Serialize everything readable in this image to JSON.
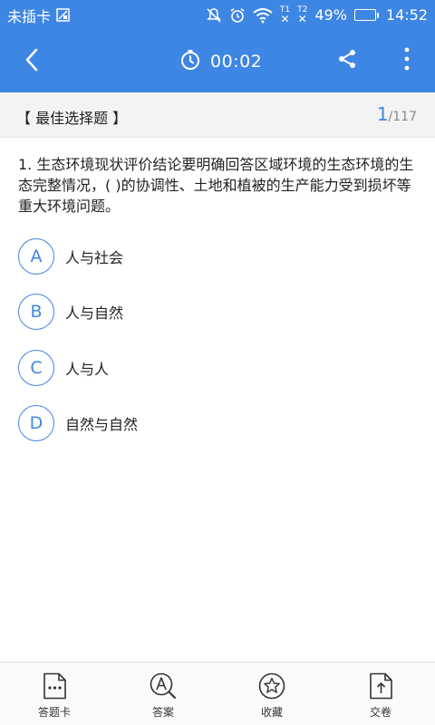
{
  "status_bar": {
    "carrier": "未插卡",
    "sim1_label": "T1",
    "sim2_label": "T2",
    "battery_percent": "49%",
    "battery_level": 0.49,
    "time": "14:52",
    "icons": [
      "sim-off-icon",
      "mute-icon",
      "alarm-icon",
      "wifi-icon",
      "signal-1-icon",
      "signal-2-icon",
      "battery-icon"
    ]
  },
  "app_bar": {
    "timer": "00:02",
    "icons": [
      "back-arrow-icon",
      "stopwatch-icon",
      "share-icon",
      "more-vertical-icon"
    ]
  },
  "question_header": {
    "type_label": "【 最佳选择题 】",
    "current": "1",
    "total": "/117"
  },
  "question": {
    "text": "1. 生态环境现状评价结论要明确回答区域环境的生态环境的生态完整情况，(  )的协调性、土地和植被的生产能力受到损坏等重大环境问题。"
  },
  "options": [
    {
      "letter": "A",
      "text": "人与社会"
    },
    {
      "letter": "B",
      "text": "人与自然"
    },
    {
      "letter": "C",
      "text": "人与人"
    },
    {
      "letter": "D",
      "text": "自然与自然"
    }
  ],
  "bottom_bar": {
    "tabs": [
      {
        "label": "答题卡",
        "icon": "answer-card-icon"
      },
      {
        "label": "答案",
        "icon": "answer-search-icon"
      },
      {
        "label": "收藏",
        "icon": "star-icon"
      },
      {
        "label": "交卷",
        "icon": "submit-icon"
      }
    ]
  },
  "colors": {
    "primary": "#3e86e3",
    "header_bg": "#f3f3f3",
    "text": "#222222"
  }
}
